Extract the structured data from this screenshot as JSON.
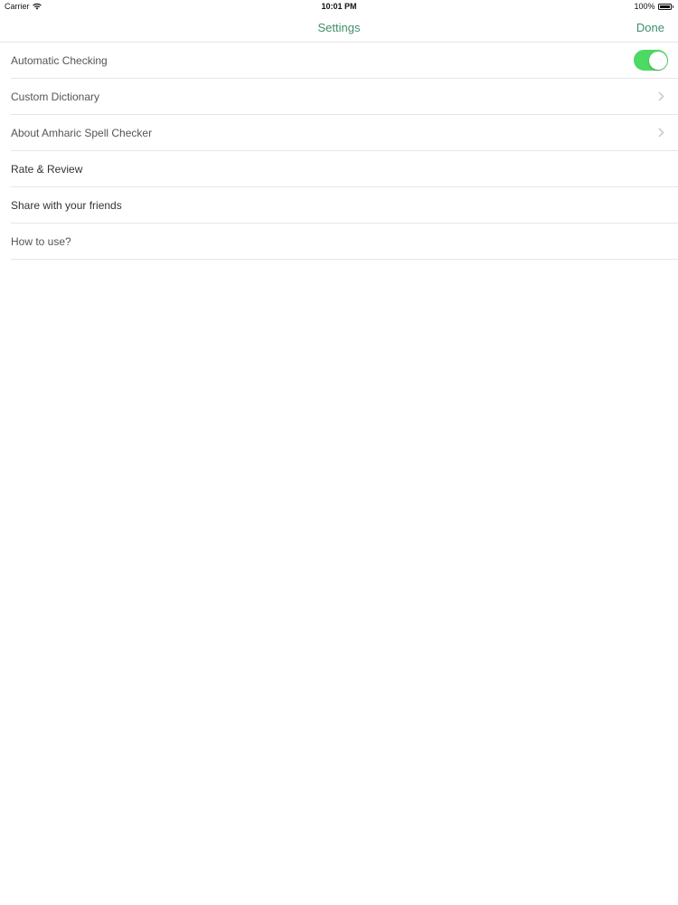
{
  "status_bar": {
    "carrier": "Carrier",
    "time": "10:01 PM",
    "battery": "100%",
    "battery_level": 1.0,
    "icons": [
      "wifi-icon",
      "battery-icon"
    ]
  },
  "nav_bar": {
    "title": "Settings",
    "done_label": "Done"
  },
  "colors": {
    "accent": "#3f8e6b",
    "toggle_on": "#4cd964",
    "separator": "#e6e6e6"
  },
  "settings": {
    "automatic_checking": {
      "label": "Automatic Checking",
      "enabled": true
    },
    "custom_dictionary": {
      "label": "Custom Dictionary",
      "icon": "chevron-right-icon"
    },
    "about": {
      "label": "About Amharic Spell Checker",
      "icon": "chevron-right-icon"
    },
    "rate_review": {
      "label": "Rate & Review"
    },
    "share": {
      "label": "Share with your friends"
    },
    "how_to_use": {
      "label": "How to use?"
    }
  }
}
